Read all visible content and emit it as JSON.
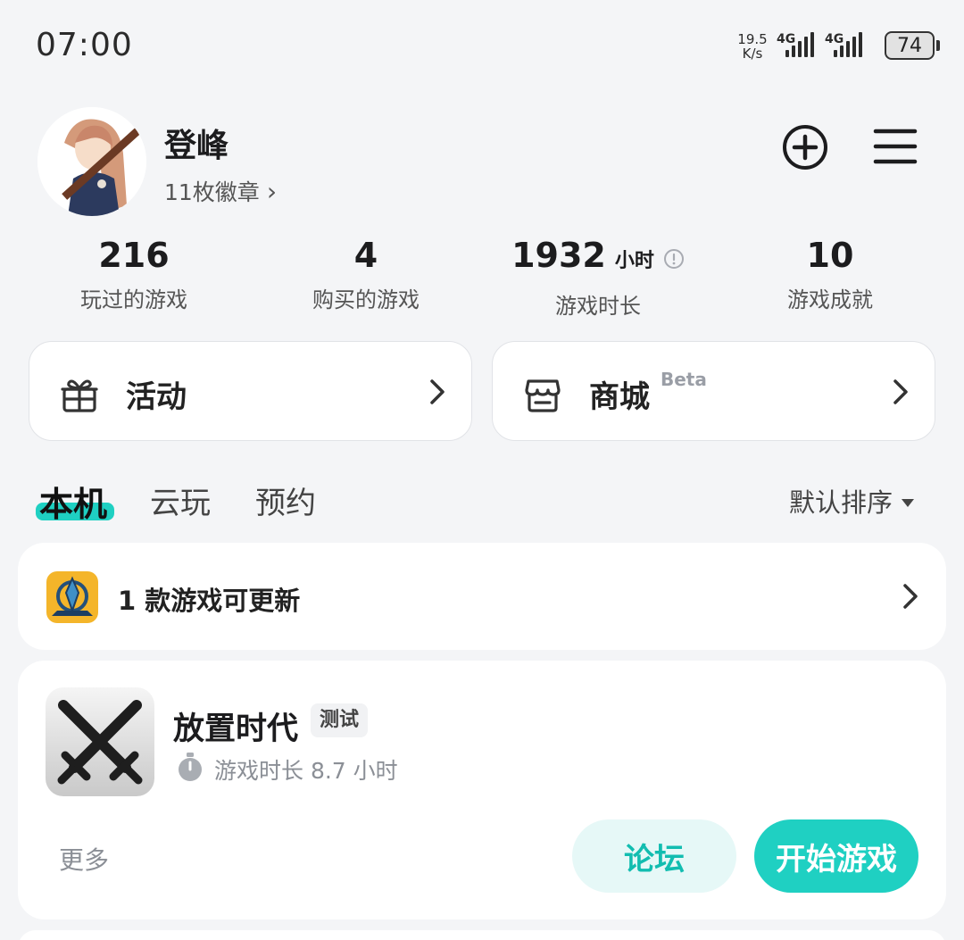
{
  "status_bar": {
    "time": "07:00",
    "net_speed_value": "19.5",
    "net_speed_unit": "K/s",
    "sim1_label": "4G",
    "sim2_label": "4G",
    "battery": "74"
  },
  "profile": {
    "username": "登峰",
    "badges_label": "11枚徽章",
    "badges_chevron": "›"
  },
  "stats": [
    {
      "value": "216",
      "unit": "",
      "label": "玩过的游戏"
    },
    {
      "value": "4",
      "unit": "",
      "label": "购买的游戏"
    },
    {
      "value": "1932",
      "unit": "小时",
      "label": "游戏时长"
    },
    {
      "value": "10",
      "unit": "",
      "label": "游戏成就"
    }
  ],
  "quick_links": {
    "events_label": "活动",
    "store_label": "商城",
    "store_badge": "Beta"
  },
  "tabs": [
    {
      "label": "本机"
    },
    {
      "label": "云玩"
    },
    {
      "label": "预约"
    }
  ],
  "sort_label": "默认排序",
  "update_banner": {
    "text": "1 款游戏可更新"
  },
  "game": {
    "title": "放置时代",
    "tag": "测试",
    "playtime": "游戏时长 8.7 小时",
    "more_label": "更多",
    "forum_label": "论坛",
    "start_label": "开始游戏"
  },
  "colors": {
    "accent": "#1fd0c2",
    "forum_bg": "#e6f8f7",
    "forum_text": "#12bdb0",
    "page_bg": "#f4f5f7"
  }
}
